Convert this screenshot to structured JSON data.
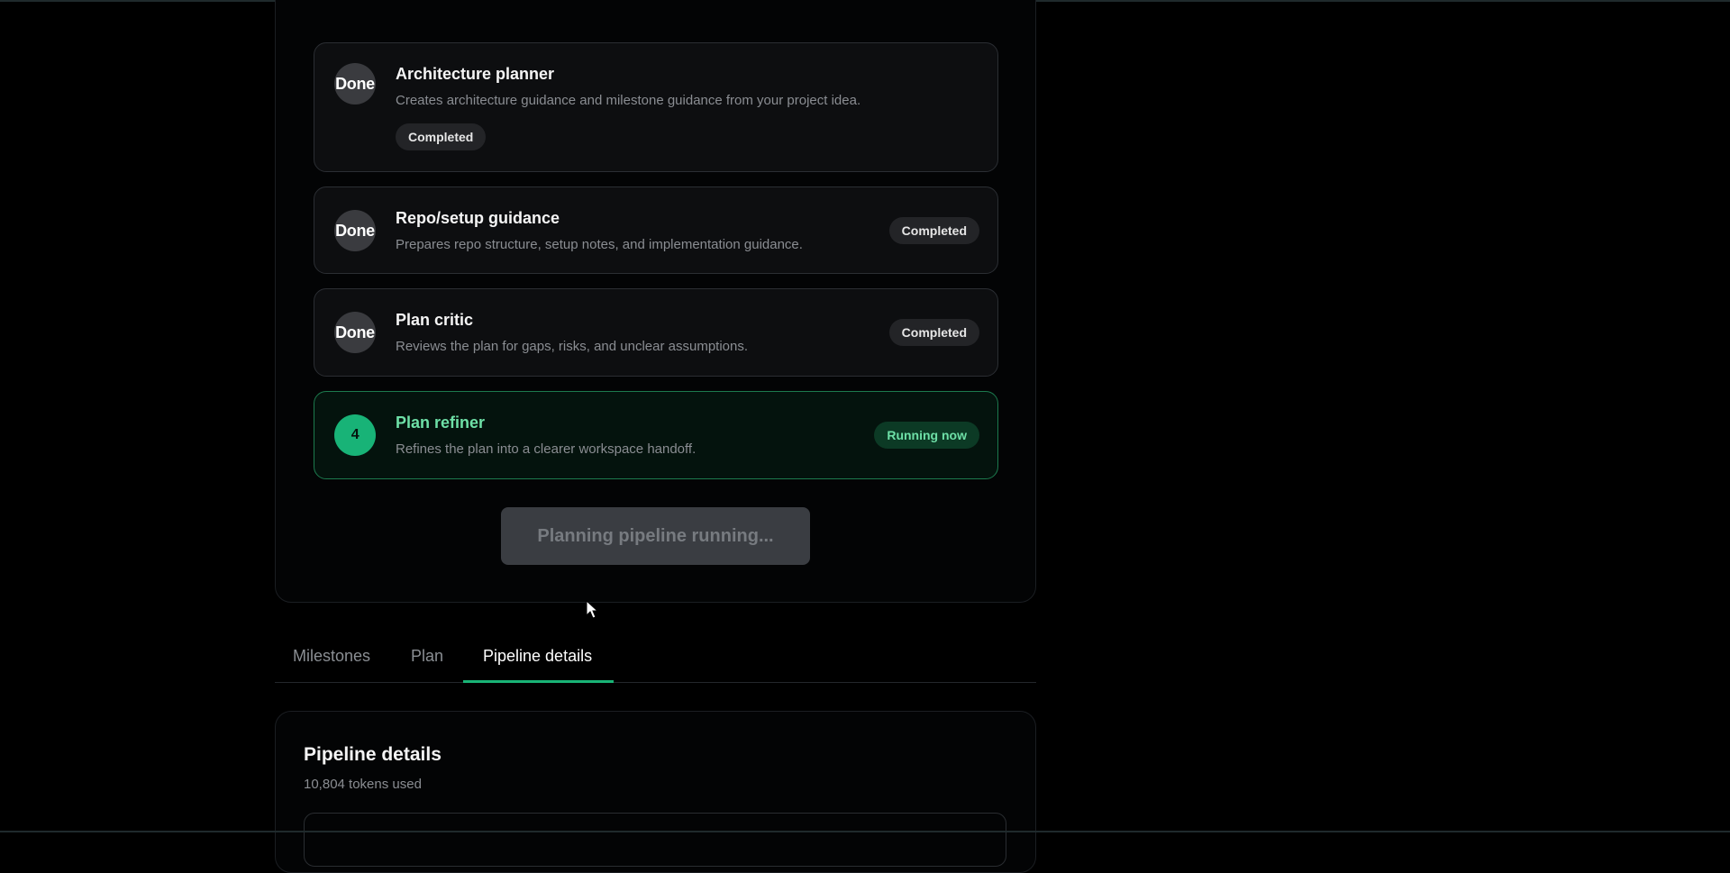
{
  "pipeline": {
    "steps": [
      {
        "badge": "Done",
        "title": "Architecture planner",
        "description": "Creates architecture guidance and milestone guidance from your project idea.",
        "status": "Completed"
      },
      {
        "badge": "Done",
        "title": "Repo/setup guidance",
        "description": "Prepares repo structure, setup notes, and implementation guidance.",
        "status": "Completed"
      },
      {
        "badge": "Done",
        "title": "Plan critic",
        "description": "Reviews the plan for gaps, risks, and unclear assumptions.",
        "status": "Completed"
      },
      {
        "badge": "4",
        "title": "Plan refiner",
        "description": "Refines the plan into a clearer workspace handoff.",
        "status": "Running now"
      }
    ],
    "run_button_label": "Planning pipeline running..."
  },
  "tabs": [
    {
      "label": "Milestones"
    },
    {
      "label": "Plan"
    },
    {
      "label": "Pipeline details"
    }
  ],
  "details": {
    "title": "Pipeline details",
    "tokens_used": "10,804 tokens used"
  },
  "colors": {
    "accent_green": "#19b476",
    "running_text": "#6ee0a7",
    "background": "#000000"
  }
}
